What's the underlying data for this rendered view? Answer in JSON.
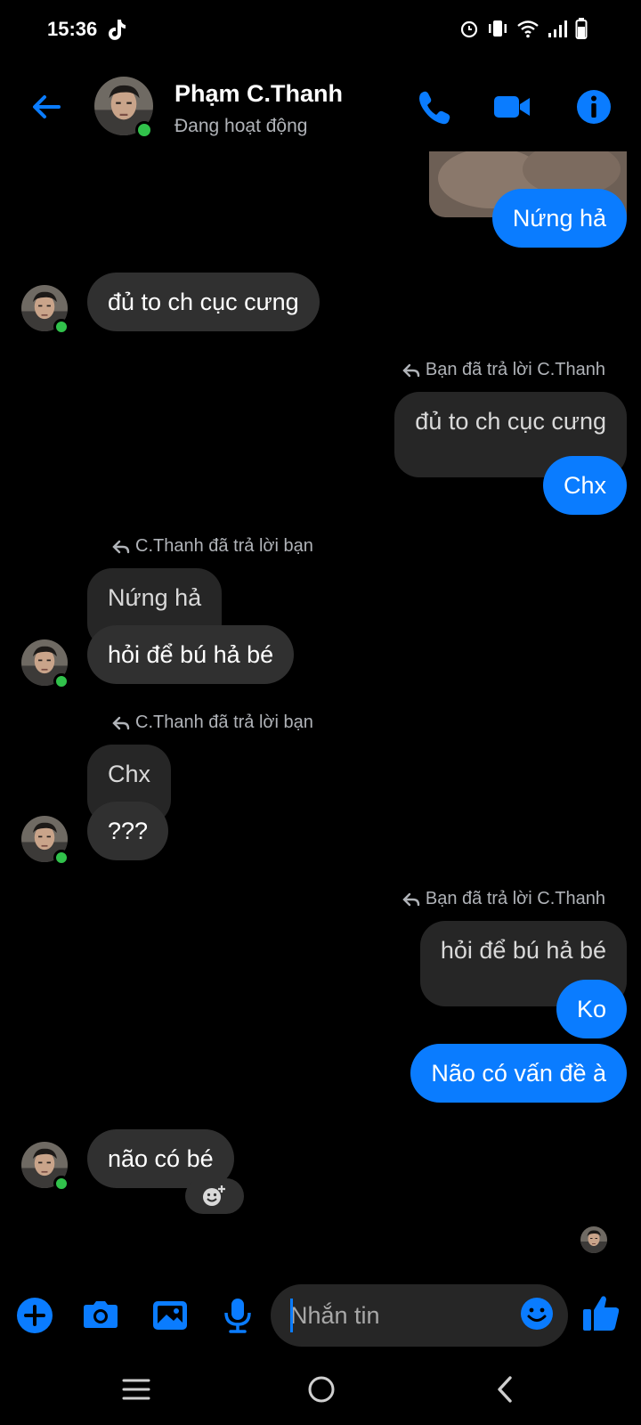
{
  "status_bar": {
    "time": "15:36",
    "icons": [
      "tiktok-icon",
      "alarm-icon",
      "vibrate-icon",
      "wifi-icon",
      "signal-icon",
      "battery-icon"
    ]
  },
  "header": {
    "name": "Phạm C.Thanh",
    "status": "Đang hoạt động",
    "icons": [
      "back-arrow-icon",
      "phone-icon",
      "video-camera-icon",
      "info-icon"
    ]
  },
  "colors": {
    "accent": "#0a7cff",
    "incoming_bubble": "#303030",
    "quoted_bubble": "#262626",
    "online": "#31c24b",
    "background": "#000000"
  },
  "messages": [
    {
      "id": "m1",
      "direction": "out",
      "text": "Nứng hả"
    },
    {
      "id": "m2",
      "direction": "in",
      "text": "đủ to ch cục cưng"
    },
    {
      "id": "m3",
      "direction": "out",
      "reply_note": "Bạn đã trả lời C.Thanh",
      "quoted": "đủ to ch cục cưng",
      "text": "Chx"
    },
    {
      "id": "m4",
      "direction": "in",
      "reply_note": "C.Thanh đã trả lời bạn",
      "quoted": "Nứng hả",
      "text": "hỏi để bú hả bé"
    },
    {
      "id": "m5",
      "direction": "in",
      "reply_note": "C.Thanh đã trả lời bạn",
      "quoted": "Chx",
      "text": "???"
    },
    {
      "id": "m6",
      "direction": "out",
      "reply_note": "Bạn đã trả lời C.Thanh",
      "quoted": "hỏi để bú hả bé",
      "text": "Ko"
    },
    {
      "id": "m7",
      "direction": "out",
      "text": "Não có vấn đề à"
    },
    {
      "id": "m8",
      "direction": "in",
      "text": "não có bé"
    }
  ],
  "composer": {
    "placeholder": "Nhắn tin",
    "icons": [
      "plus-icon",
      "camera-icon",
      "gallery-icon",
      "microphone-icon",
      "emoji-icon",
      "thumbs-up-icon"
    ]
  },
  "nav_bar": {
    "icons": [
      "recent-apps-icon",
      "home-icon",
      "back-icon"
    ]
  }
}
